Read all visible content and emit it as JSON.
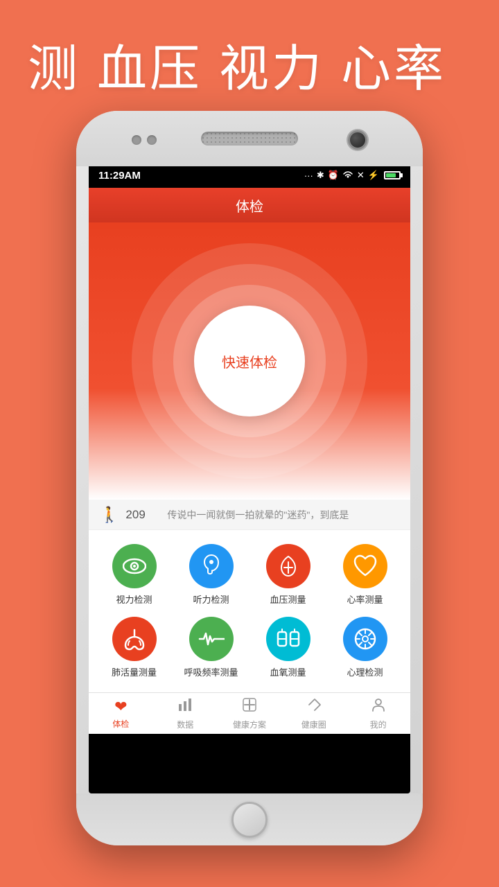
{
  "hero": {
    "title": "测 血压 视力 心率"
  },
  "statusBar": {
    "time": "11:29AM",
    "dots": "...",
    "bluetooth": "⚡",
    "alarm": "⏰",
    "wifi": "WiFi",
    "charge": "⚡"
  },
  "appHeader": {
    "title": "体检"
  },
  "mainButton": {
    "label": "快速体检"
  },
  "stepBar": {
    "count": "209",
    "news": "传说中一闻就倒一拍就晕的\"迷药\"，到底是"
  },
  "features": [
    {
      "id": "vision",
      "label": "视力检测",
      "colorClass": "icon-green",
      "icon": "👁"
    },
    {
      "id": "hearing",
      "label": "听力检测",
      "colorClass": "icon-blue",
      "icon": "👂"
    },
    {
      "id": "bloodpressure",
      "label": "血压测量",
      "colorClass": "icon-red",
      "icon": "🌡"
    },
    {
      "id": "heartrate",
      "label": "心率测量",
      "colorClass": "icon-orange",
      "icon": "❤"
    },
    {
      "id": "lungcapacity",
      "label": "肺活量测量",
      "colorClass": "icon-orange-red",
      "icon": "🫁"
    },
    {
      "id": "breathing",
      "label": "呼吸频率测量",
      "colorClass": "icon-green2",
      "icon": "📊"
    },
    {
      "id": "bloodoxygen",
      "label": "血氧测量",
      "colorClass": "icon-teal",
      "icon": "⬡"
    },
    {
      "id": "psychology",
      "label": "心理检测",
      "colorClass": "icon-blue",
      "icon": "⚙"
    }
  ],
  "bottomNav": [
    {
      "id": "exam",
      "label": "体检",
      "active": true
    },
    {
      "id": "data",
      "label": "数据",
      "active": false
    },
    {
      "id": "health",
      "label": "健康方案",
      "active": false
    },
    {
      "id": "circle",
      "label": "健康圈",
      "active": false
    },
    {
      "id": "mine",
      "label": "我的",
      "active": false
    }
  ]
}
